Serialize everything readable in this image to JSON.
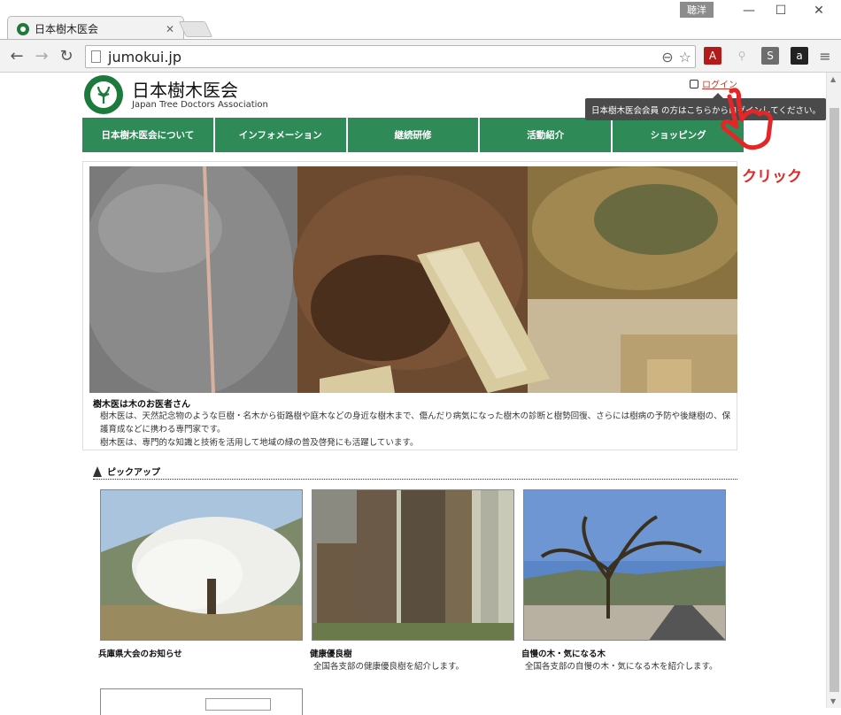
{
  "browser": {
    "tab_title": "日本樹木医会",
    "profile_name": "聴洋",
    "url": "jumokui.jp",
    "window_controls": [
      "minimize-icon",
      "maximize-icon",
      "close-icon"
    ]
  },
  "site": {
    "name": "日本樹木医会",
    "subtitle": "Japan Tree Doctors Association",
    "login_label": "ログイン",
    "login_tooltip": "日本樹木医会会員 の方はこちらからログインしてください。",
    "nav": [
      "日本樹木医会について",
      "インフォメーション",
      "継続研修",
      "活動紹介",
      "ショッピング"
    ]
  },
  "hero": {
    "title": "樹木医は木のお医者さん",
    "paragraph1": "樹木医は、天然記念物のような巨樹・名木から街路樹や庭木などの身近な樹木まで、傷んだり病気になった樹木の診断と樹勢回復、さらには樹病の予防や後継樹の、保護育成などに携わる専門家です。",
    "paragraph2": "樹木医は、専門的な知識と技術を活用して地域の緑の普及啓発にも活躍しています。"
  },
  "pickup": {
    "heading": "ピックアップ",
    "cards": [
      {
        "title": "兵庫県大会のお知らせ",
        "desc": ""
      },
      {
        "title": "健康優良樹",
        "desc": "全国各支部の健康優良樹を紹介します。"
      },
      {
        "title": "自慢の木・気になる木",
        "desc": "全国各支部の自慢の木・気になる木を紹介します。"
      }
    ]
  },
  "annotation": "クリック",
  "colors": {
    "nav_green": "#2e8b57",
    "login_red": "#c0392b",
    "annotation_red": "#e32626"
  }
}
